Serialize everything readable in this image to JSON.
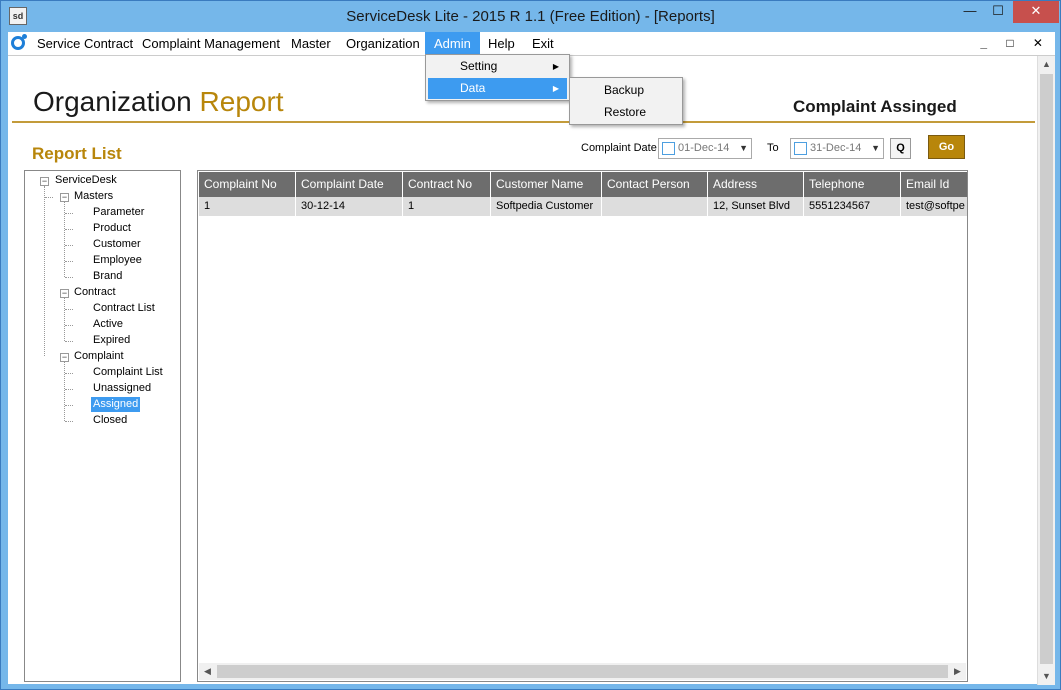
{
  "window": {
    "icon_text": "sd",
    "title": "ServiceDesk Lite - 2015 R 1.1 (Free Edition) - [Reports]",
    "min": "—",
    "max": "☐",
    "close": "✕"
  },
  "menubar": {
    "items": [
      "Service Contract",
      "Complaint Management",
      "Master",
      "Organization",
      "Admin",
      "Help",
      "Exit"
    ],
    "active": "Admin",
    "mdi_controls": "_ □ ✕"
  },
  "admin_menu": {
    "items": [
      {
        "label": "Setting",
        "arrow": "▶"
      },
      {
        "label": "Data",
        "arrow": "▶"
      }
    ],
    "hovered": "Data"
  },
  "data_submenu": {
    "items": [
      "Backup",
      "Restore"
    ]
  },
  "header": {
    "title_part1": "Organization",
    "title_part2": "Report",
    "right_title": "Complaint Assinged"
  },
  "report_list": {
    "title": "Report List"
  },
  "filters": {
    "complaint_date_label": "Complaint Date",
    "from_date": "01-Dec-14",
    "to_label": "To",
    "to_date": "31-Dec-14",
    "dropdown_glyph": "▼",
    "q_label": "Q",
    "go_label": "Go"
  },
  "tree": {
    "root": "ServiceDesk",
    "masters": {
      "label": "Masters",
      "children": [
        "Parameter",
        "Product",
        "Customer",
        "Employee",
        "Brand"
      ]
    },
    "contract": {
      "label": "Contract",
      "children": [
        "Contract List",
        "Active",
        "Expired"
      ]
    },
    "complaint": {
      "label": "Complaint",
      "children": [
        "Complaint List",
        "Unassigned",
        "Assigned",
        "Closed"
      ]
    },
    "selected": "Assigned",
    "toggle": "−"
  },
  "grid": {
    "columns": [
      "Complaint No",
      "Complaint Date",
      "Contract No",
      "Customer Name",
      "Contact Person",
      "Address",
      "Telephone",
      "Email Id"
    ],
    "rows": [
      [
        "1",
        "30-12-14",
        "1",
        "Softpedia Customer",
        "",
        "12, Sunset Blvd",
        "5551234567",
        "test@softpe"
      ]
    ]
  },
  "scroll": {
    "up": "▲",
    "down": "▼",
    "left": "◀",
    "right": "▶"
  },
  "colors": {
    "accent_gold": "#b8860b",
    "selection_blue": "#3d9bf0",
    "titlebar": "#75b7ea",
    "grid_header": "#6d6d6d"
  }
}
